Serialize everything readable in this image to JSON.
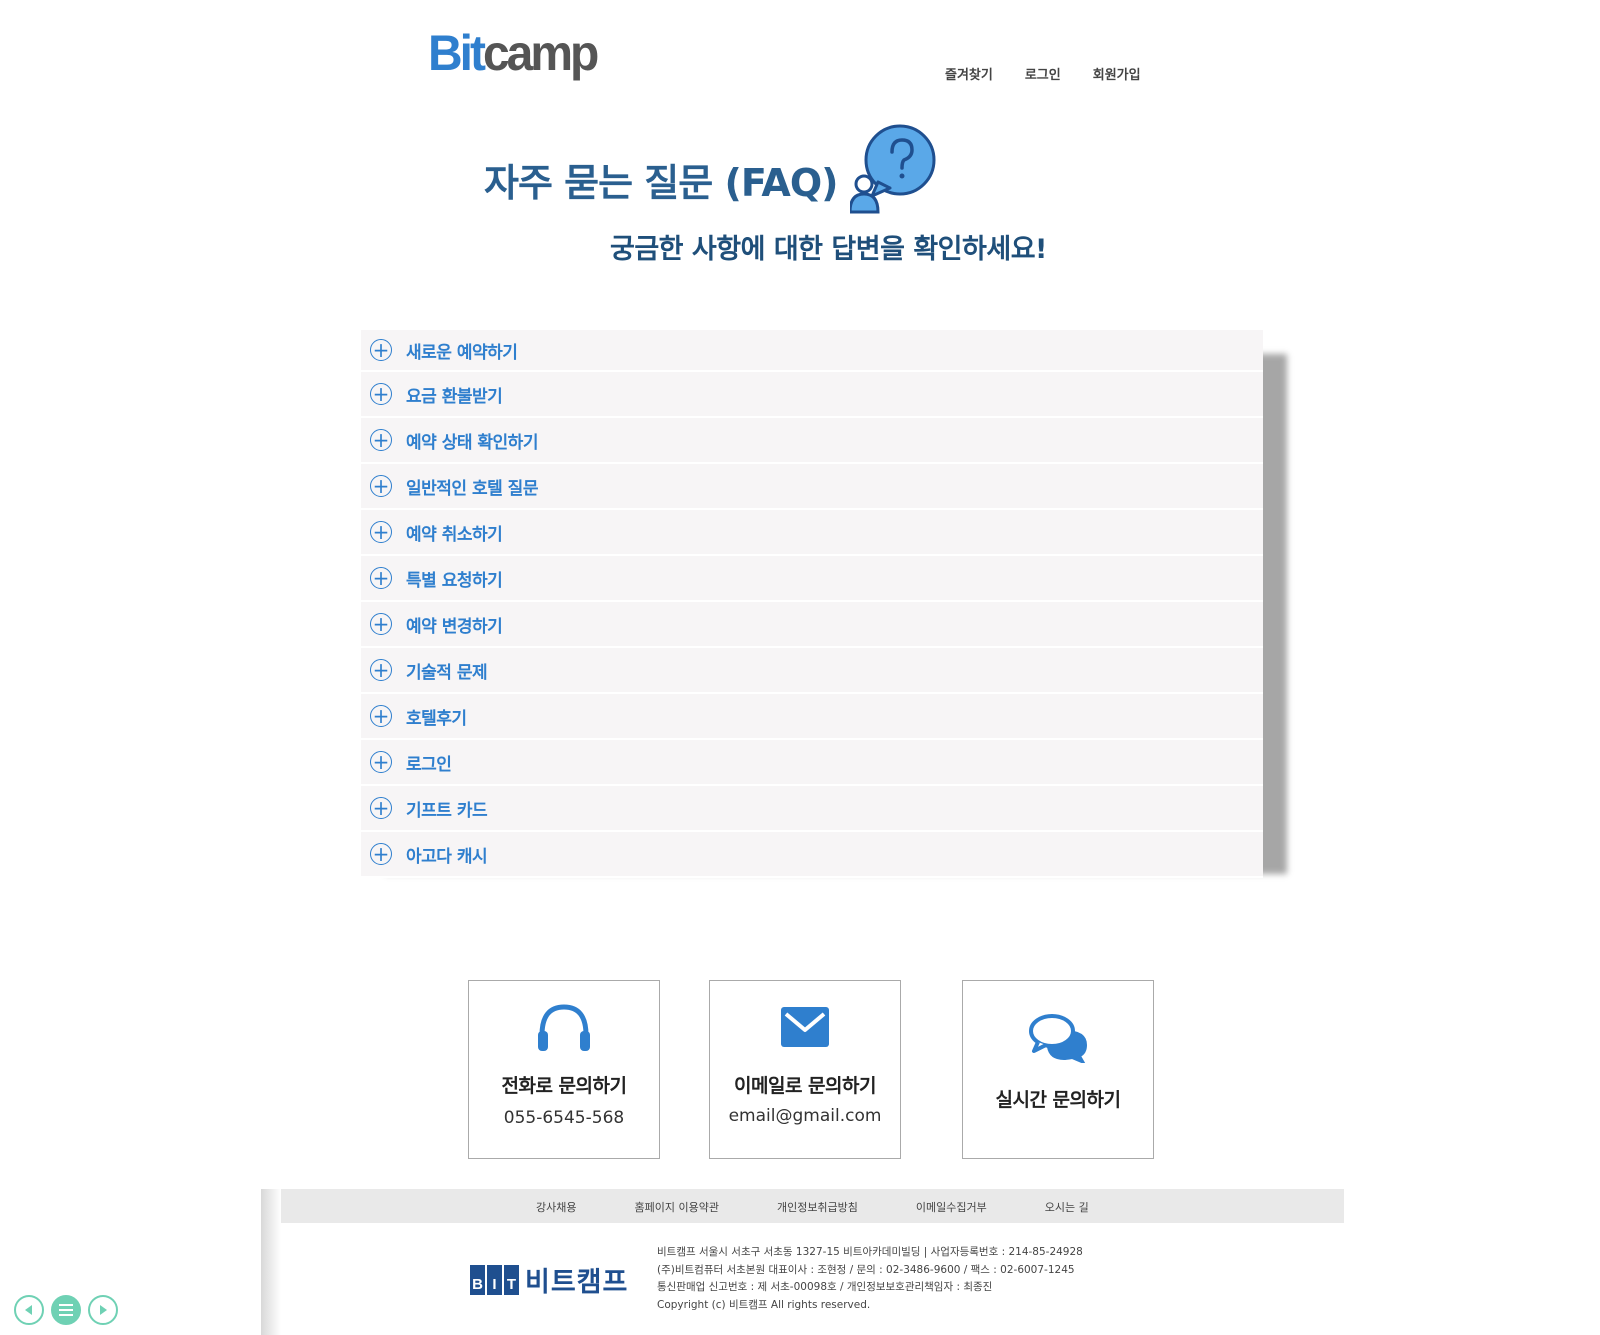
{
  "header": {
    "logo_bit": "Bit",
    "logo_camp": "camp",
    "nav": [
      "즐겨찾기",
      "로그인",
      "회원가입"
    ]
  },
  "faq": {
    "title": "자주 묻는 질문 (FAQ)",
    "subtitle": "궁금한 사항에 대한 답변을 확인하세요!",
    "items": [
      "새로운 예약하기",
      "요금 환불받기",
      "예약 상태 확인하기",
      "일반적인 호텔 질문",
      "예약 취소하기",
      "특별 요청하기",
      "예약 변경하기",
      "기술적 문제",
      "호텔후기",
      "로그인",
      "기프트 카드",
      "아고다 캐시"
    ]
  },
  "contact": {
    "phone": {
      "title": "전화로  문의하기",
      "value": "055-6545-568",
      "icon": "headset-icon"
    },
    "email": {
      "title": "이메일로  문의하기",
      "value": "email@gmail.com",
      "icon": "envelope-icon"
    },
    "chat": {
      "title": "실시간  문의하기",
      "icon": "chat-bubbles-icon"
    }
  },
  "footer": {
    "links": [
      "강사채용",
      "홈페이지 이용약관",
      "개인정보취급방침",
      "이메일수집거부",
      "오시는 길"
    ],
    "logo_letters": [
      "B",
      "I",
      "T"
    ],
    "logo_name": "비트캠프",
    "info": [
      "비트캠프 서울시 서초구 서초동 1327-15 비트아카데미빌딩 |  사업자등록번호 : 214-85-24928",
      "(주)비트컴퓨터 서초본원 대표이사 : 조현정 / 문의 : 02-3486-9600 / 팩스 : 02-6007-1245",
      "통신판매업 신고번호 : 제 서초-00098호 / 개인정보보호관리책임자 : 최종진",
      "Copyright (c) 비트캠프 All rights reserved."
    ]
  },
  "colors": {
    "accent": "#2f7fce",
    "title": "#2a5f8f",
    "nav_buttons": "#6fd1b4"
  }
}
